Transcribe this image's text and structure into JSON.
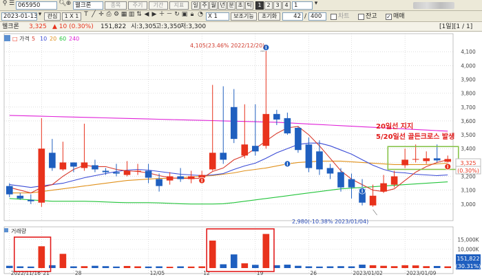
{
  "toolbar1": {
    "code": "065950",
    "name": "웰크론",
    "buttons": [
      "종목",
      "주기",
      "기간",
      "지표"
    ],
    "periods": [
      "주",
      "월",
      "년",
      "분",
      "초",
      "틱"
    ],
    "active_period": "일",
    "count_buttons": [
      "1",
      "2",
      "3",
      "4"
    ],
    "count_value": "1"
  },
  "toolbar2": {
    "date": "2023-01-13",
    "interest_label": "관심",
    "unit_label": "1 X 1",
    "multiplier": "X 1",
    "visible_count": "42",
    "total_count": "400",
    "helper_label": "보조기능",
    "reset_label": "초기화",
    "toggle1_label": "차트",
    "toggle2_label": "잔고",
    "toggle3_label": "매매"
  },
  "infobar": {
    "name": "웰크론",
    "price": "3,325",
    "change": "▲ 10 (0.30%)",
    "volume": "151,822",
    "open": "시:3,305",
    "high": "고:3,350",
    "low": "저:3,300",
    "period_label": "[1일][1 / 1]"
  },
  "legend": {
    "price_label": "가격",
    "ma": [
      "5",
      "10",
      "20",
      "60",
      "240"
    ]
  },
  "volume_label": "거래량",
  "annotations": {
    "high": "4,105(23.46% 2022/12/20)",
    "low": "2,980(-10.38% 2023/01/04)",
    "callout_line1": "20일선 지지",
    "callout_line2": "5/20일선 골든크로스 발생"
  },
  "colors": {
    "up": "#e8321c",
    "down": "#1f5fbf",
    "ma5": "#d9392b",
    "ma10": "#3a4bd6",
    "ma20": "#e0901a",
    "ma60": "#22c43a",
    "ma240": "#e020d8",
    "box_red": "#e21b1b",
    "box_green": "#88c34a"
  },
  "chart_data": {
    "type": "candlestick",
    "dates": [
      "11/16",
      "11/17",
      "11/18",
      "11/21",
      "11/22",
      "11/23",
      "11/24",
      "11/25",
      "11/28",
      "11/29",
      "11/30",
      "12/01",
      "12/02",
      "12/05",
      "12/06",
      "12/07",
      "12/08",
      "12/09",
      "12/12",
      "12/13",
      "12/14",
      "12/15",
      "12/16",
      "12/19",
      "12/20",
      "12/21",
      "12/22",
      "12/23",
      "12/26",
      "12/27",
      "12/28",
      "12/29",
      "01/02",
      "01/03",
      "01/04",
      "01/05",
      "01/06",
      "01/09",
      "01/10",
      "01/11",
      "01/12",
      "01/13"
    ],
    "open": [
      3130,
      3060,
      3030,
      3010,
      3370,
      3250,
      3300,
      3260,
      3280,
      3240,
      3230,
      3210,
      3240,
      3240,
      3180,
      3170,
      3200,
      3180,
      3190,
      3250,
      3370,
      3700,
      3350,
      3420,
      3420,
      3650,
      3620,
      3550,
      3430,
      3380,
      3260,
      3230,
      3180,
      3110,
      2990,
      3090,
      3140,
      3280,
      3320,
      3310,
      3330,
      3305
    ],
    "close": [
      3070,
      3040,
      3020,
      3400,
      3260,
      3300,
      3270,
      3300,
      3250,
      3230,
      3220,
      3240,
      3240,
      3190,
      3130,
      3200,
      3180,
      3200,
      3210,
      3370,
      3320,
      3470,
      3430,
      3380,
      3650,
      3610,
      3510,
      3390,
      3260,
      3250,
      3220,
      3120,
      3120,
      3010,
      3060,
      3150,
      3200,
      3320,
      3325,
      3330,
      3315,
      3325
    ],
    "high": [
      3150,
      3080,
      3070,
      3620,
      3470,
      3450,
      3300,
      3580,
      3320,
      3260,
      3290,
      3310,
      3290,
      3290,
      3220,
      3230,
      3260,
      3240,
      3240,
      3860,
      3850,
      3830,
      3720,
      3720,
      4105,
      3680,
      3660,
      3560,
      3480,
      3460,
      3290,
      3260,
      3220,
      3180,
      3140,
      3210,
      3240,
      3400,
      3430,
      3380,
      3430,
      3350
    ],
    "low": [
      3050,
      3030,
      3000,
      2980,
      3240,
      3240,
      3230,
      3240,
      3230,
      3210,
      3200,
      3200,
      3210,
      3150,
      3090,
      3140,
      3160,
      3150,
      3180,
      3240,
      3290,
      3440,
      3330,
      3350,
      3400,
      3570,
      3500,
      3370,
      3230,
      3210,
      3180,
      3090,
      3040,
      2990,
      2980,
      3080,
      3120,
      3260,
      3300,
      3290,
      3300,
      3300
    ],
    "ma5": [
      3120,
      3100,
      3080,
      3120,
      3140,
      3200,
      3250,
      3280,
      3270,
      3270,
      3250,
      3240,
      3235,
      3225,
      3205,
      3190,
      3185,
      3185,
      3185,
      3235,
      3260,
      3320,
      3350,
      3400,
      3455,
      3510,
      3550,
      3560,
      3500,
      3420,
      3330,
      3240,
      3180,
      3140,
      3100,
      3090,
      3110,
      3170,
      3230,
      3270,
      3300,
      3320
    ],
    "ma10": [
      3140,
      3130,
      3120,
      3130,
      3140,
      3150,
      3170,
      3190,
      3205,
      3220,
      3235,
      3245,
      3250,
      3245,
      3235,
      3225,
      3215,
      3210,
      3205,
      3210,
      3220,
      3250,
      3275,
      3295,
      3330,
      3370,
      3400,
      3430,
      3440,
      3440,
      3420,
      3390,
      3360,
      3320,
      3280,
      3250,
      3230,
      3225,
      3215,
      3210,
      3205,
      3210
    ],
    "ma20": [
      3080,
      3080,
      3080,
      3090,
      3100,
      3110,
      3120,
      3130,
      3140,
      3150,
      3160,
      3170,
      3175,
      3180,
      3185,
      3185,
      3190,
      3195,
      3200,
      3205,
      3215,
      3225,
      3240,
      3250,
      3260,
      3275,
      3290,
      3300,
      3305,
      3310,
      3310,
      3310,
      3305,
      3300,
      3295,
      3290,
      3285,
      3285,
      3285,
      3285,
      3290,
      3295
    ],
    "ma60": [
      3040,
      3035,
      3030,
      3025,
      3020,
      3020,
      3020,
      3020,
      3018,
      3015,
      3012,
      3010,
      3010,
      3010,
      3008,
      3005,
      3002,
      3000,
      3000,
      3000,
      3002,
      3010,
      3020,
      3030,
      3040,
      3050,
      3060,
      3070,
      3080,
      3090,
      3100,
      3110,
      3115,
      3120,
      3125,
      3130,
      3135,
      3140,
      3145,
      3150,
      3155,
      3160
    ],
    "ma240": [
      3640,
      3638,
      3636,
      3634,
      3632,
      3630,
      3628,
      3626,
      3624,
      3622,
      3620,
      3618,
      3616,
      3614,
      3612,
      3610,
      3608,
      3606,
      3604,
      3602,
      3600,
      3598,
      3596,
      3594,
      3592,
      3590,
      3586,
      3582,
      3578,
      3574,
      3570,
      3566,
      3562,
      3558,
      3554,
      3550,
      3546,
      3542,
      3538,
      3534,
      3530,
      3526
    ],
    "volume": [
      1200,
      900,
      800,
      11500,
      1500,
      7500,
      900,
      1000,
      1200,
      1000,
      800,
      1100,
      900,
      800,
      900,
      700,
      900,
      800,
      900,
      14500,
      2000,
      7200,
      2500,
      1700,
      18000,
      1500,
      1800,
      1200,
      900,
      800,
      900,
      1000,
      900,
      1800,
      1500,
      1200,
      1000,
      1500,
      1400,
      1000,
      1100,
      900
    ],
    "ylim": [
      2900,
      4200
    ],
    "y_ticks": [
      3000,
      3100,
      3200,
      3300,
      3400,
      3500,
      3600,
      3700,
      3800,
      3900,
      4000,
      4100
    ],
    "y_tick_labels": [
      "3,000",
      "3,100",
      "3,200",
      "3,300",
      "3,400",
      "3,500",
      "3,600",
      "3,700",
      "3,800",
      "3,900",
      "4,000",
      "4,100"
    ],
    "vol_ticks": [
      15000,
      10000,
      5000
    ],
    "vol_tick_labels": [
      "15,000K",
      "10,000K",
      "5,000K"
    ],
    "current_price_label": "3,325",
    "current_change_label": "(0.30%)",
    "current_volume_label": "151,822",
    "current_volume_change": "(30.31%)",
    "x_labels": [
      {
        "i": 0,
        "text": "2022/11/16"
      },
      {
        "i": 3,
        "text": "21"
      },
      {
        "i": 6,
        "text": "28"
      },
      {
        "i": 13,
        "text": "12/05"
      },
      {
        "i": 18,
        "text": "12"
      },
      {
        "i": 23,
        "text": "19"
      },
      {
        "i": 28,
        "text": "26"
      },
      {
        "i": 32,
        "text": "2023/01/02"
      },
      {
        "i": 37,
        "text": "2023/01/09"
      }
    ]
  }
}
